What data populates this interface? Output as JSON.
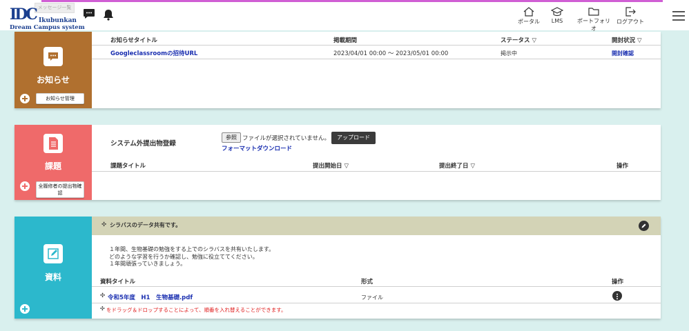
{
  "header": {
    "msg_tab": "メッセージ一覧",
    "logo_mark": "IDC",
    "logo_line1": "Ikubunkan",
    "logo_line2": "Dream Campus system",
    "nav": [
      {
        "label": "ポータル",
        "icon": "home-icon"
      },
      {
        "label": "LMS",
        "icon": "graduation-cap-icon"
      },
      {
        "label": "ポートフォリオ",
        "icon": "folder-icon"
      },
      {
        "label": "ログアウト",
        "icon": "logout-icon"
      }
    ]
  },
  "notice": {
    "title": "お知らせ",
    "manage_button": "お知らせ管理",
    "columns": [
      "お知らせタイトル",
      "掲載期間",
      "ステータス ▽",
      "開封状況 ▽"
    ],
    "rows": [
      {
        "title": "Googleclassroomの招待URL",
        "period": "2023/04/01 00:00 〜 2023/05/01 00:00",
        "status": "掲示中",
        "open": "開封確認"
      }
    ]
  },
  "assignment": {
    "title": "課題",
    "confirm_button": "全履修者の提出物確認",
    "external_label": "システム外提出物登録",
    "browse_button": "参照",
    "no_file": "ファイルが選択されていません。",
    "upload_button": "アップロード",
    "format_link": "フォーマットダウンロード",
    "columns": [
      "課題タイトル",
      "提出開始日 ▽",
      "提出終了日 ▽",
      "操作"
    ]
  },
  "materials": {
    "title": "資料",
    "banner": "シラバスのデータ共有です。",
    "description": [
      "１年間、生物基礎の勉強をする上でのシラバスを共有いたします。",
      "どのような学習を行うか確認し、勉強に役立ててください。",
      "１年間頑張っていきましょう。"
    ],
    "columns": [
      "資料タイトル",
      "形式",
      "操作"
    ],
    "rows": [
      {
        "title": "令和5年度　H1　生物基礎.pdf",
        "format": "ファイル"
      }
    ],
    "drag_hint": "をドラッグ＆ドロップすることによって、順番を入れ替えることができます。"
  },
  "colors": {
    "notice": "#b0702f",
    "assignment": "#ef6a6a",
    "materials": "#2cb8cc",
    "banner": "#d3d3b6",
    "link": "#1a2fb0",
    "hint": "#e02020"
  }
}
